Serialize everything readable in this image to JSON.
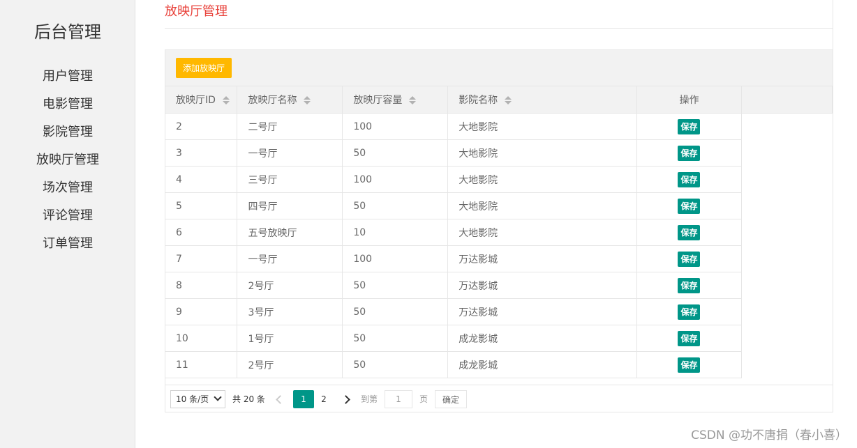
{
  "sidebar": {
    "brand": "后台管理",
    "items": [
      {
        "label": "用户管理"
      },
      {
        "label": "电影管理"
      },
      {
        "label": "影院管理"
      },
      {
        "label": "放映厅管理"
      },
      {
        "label": "场次管理"
      },
      {
        "label": "评论管理"
      },
      {
        "label": "订单管理"
      }
    ]
  },
  "main": {
    "page_title": "放映厅管理",
    "add_button_label": "添加放映厅",
    "columns": [
      "放映厅ID",
      "放映厅名称",
      "放映厅容量",
      "影院名称",
      "操作"
    ],
    "rows": [
      {
        "id": "2",
        "name": "二号厅",
        "capacity": "100",
        "cinema": "大地影院",
        "action": "保存"
      },
      {
        "id": "3",
        "name": "一号厅",
        "capacity": "50",
        "cinema": "大地影院",
        "action": "保存"
      },
      {
        "id": "4",
        "name": "三号厅",
        "capacity": "100",
        "cinema": "大地影院",
        "action": "保存"
      },
      {
        "id": "5",
        "name": "四号厅",
        "capacity": "50",
        "cinema": "大地影院",
        "action": "保存"
      },
      {
        "id": "6",
        "name": "五号放映厅",
        "capacity": "10",
        "cinema": "大地影院",
        "action": "保存"
      },
      {
        "id": "7",
        "name": "一号厅",
        "capacity": "100",
        "cinema": "万达影城",
        "action": "保存"
      },
      {
        "id": "8",
        "name": "2号厅",
        "capacity": "50",
        "cinema": "万达影城",
        "action": "保存"
      },
      {
        "id": "9",
        "name": "3号厅",
        "capacity": "50",
        "cinema": "万达影城",
        "action": "保存"
      },
      {
        "id": "10",
        "name": "1号厅",
        "capacity": "50",
        "cinema": "成龙影城",
        "action": "保存"
      },
      {
        "id": "11",
        "name": "2号厅",
        "capacity": "50",
        "cinema": "成龙影城",
        "action": "保存"
      }
    ]
  },
  "pagination": {
    "page_size": "10 条/页",
    "total": "共 20 条",
    "pages": [
      "1",
      "2"
    ],
    "goto_label": "到第",
    "page_input_value": "1",
    "page_unit": "页",
    "confirm_label": "确定"
  },
  "watermark": "CSDN @功不唐捐（春小喜）",
  "colors": {
    "title_red": "#e8413a",
    "add_button": "#ffb800",
    "save_button": "#009688",
    "active_page": "#009688"
  }
}
